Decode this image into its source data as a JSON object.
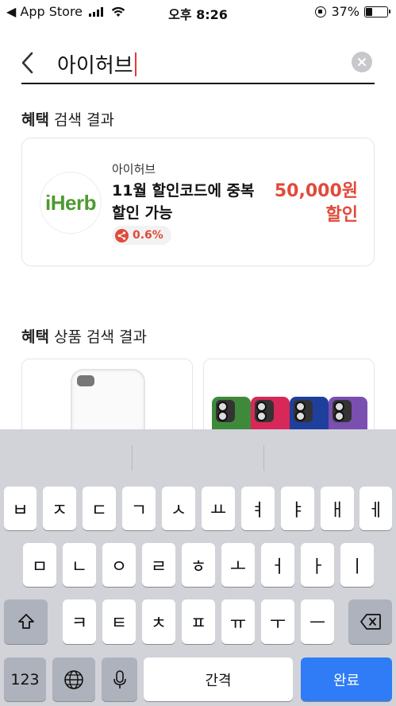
{
  "status_bar": {
    "carrier": "◀ App Store",
    "time": "오후 8:26",
    "battery": "37%",
    "battery_level": 0.37
  },
  "search": {
    "query": "아이허브"
  },
  "benefit_section": {
    "title_bold": "혜택",
    "title_rest": " 검색 결과",
    "card": {
      "logo_text": "iHerb",
      "brand": "아이허브",
      "title": "11월 할인코드에 중복할인 가능",
      "share_rate": "0.6%",
      "discount_amount": "50,000원",
      "discount_label": "할인"
    }
  },
  "product_section": {
    "title_bold": "혜택",
    "title_rest": " 상품 검색 결과"
  },
  "keyboard": {
    "row1": [
      "ㅂ",
      "ㅈ",
      "ㄷ",
      "ㄱ",
      "ㅅ",
      "ㅛ",
      "ㅕ",
      "ㅑ",
      "ㅐ",
      "ㅔ"
    ],
    "row2": [
      "ㅁ",
      "ㄴ",
      "ㅇ",
      "ㄹ",
      "ㅎ",
      "ㅗ",
      "ㅓ",
      "ㅏ",
      "ㅣ"
    ],
    "row3": [
      "ㅋ",
      "ㅌ",
      "ㅊ",
      "ㅍ",
      "ㅠ",
      "ㅜ",
      "ㅡ"
    ],
    "numbers_key": "123",
    "space_key": "간격",
    "done_key": "완료"
  },
  "colors": {
    "accent_red": "#e04a3a",
    "iherb_green": "#4e9a2e",
    "done_blue": "#2f7cf6"
  }
}
